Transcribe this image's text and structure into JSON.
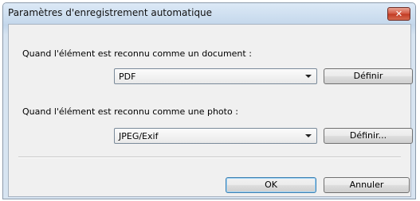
{
  "window": {
    "title": "Paramètres d'enregistrement automatique",
    "close_glyph": "✕"
  },
  "document_section": {
    "label": "Quand l'élément est reconnu comme un document :",
    "format_value": "PDF",
    "define_button": "Définir"
  },
  "photo_section": {
    "label": "Quand l'élément est reconnu comme une photo :",
    "format_value": "JPEG/Exif",
    "define_button": "Définir..."
  },
  "footer": {
    "ok_button": "OK",
    "cancel_button": "Annuler"
  },
  "icons": {
    "dropdown_arrow": "chevron-down-icon",
    "close": "close-icon"
  }
}
